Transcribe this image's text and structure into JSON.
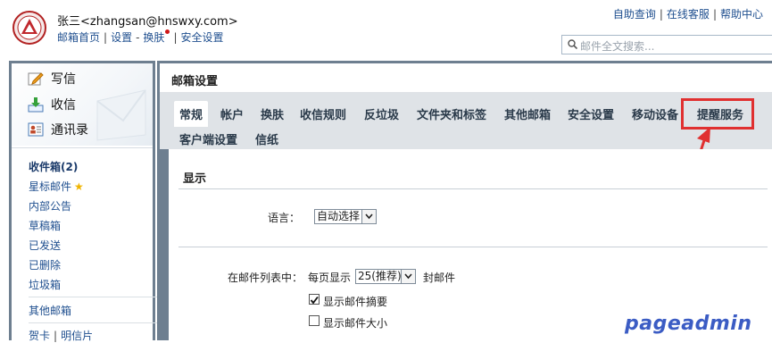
{
  "header": {
    "user": "张三<zhangsan@hnswxy.com>",
    "links": [
      "邮箱首页",
      "设置",
      "换肤",
      "安全设置"
    ],
    "help_links": [
      "自助查询",
      "在线客服",
      "帮助中心"
    ],
    "search_placeholder": "邮件全文搜索..."
  },
  "sidebar": {
    "actions": [
      {
        "label": "写信",
        "icon": "compose-icon"
      },
      {
        "label": "收信",
        "icon": "inbox-download-icon"
      },
      {
        "label": "通讯录",
        "icon": "contacts-icon"
      }
    ],
    "folders": [
      "收件箱(2)",
      "星标邮件",
      "内部公告",
      "草稿箱",
      "已发送",
      "已删除",
      "垃圾箱"
    ],
    "other": "其他邮箱",
    "bottom": [
      "贺卡",
      "明信片"
    ]
  },
  "main": {
    "title": "邮箱设置",
    "tabs": [
      "常规",
      "帐户",
      "换肤",
      "收信规则",
      "反垃圾",
      "文件夹和标签",
      "其他邮箱",
      "安全设置",
      "移动设备",
      "提醒服务",
      "客户端设置",
      "信纸"
    ],
    "active_tab": "常规",
    "highlighted_tab": "提醒服务",
    "section_title": "显示",
    "language_label": "语言：",
    "language_value": "自动选择",
    "list_label": "在邮件列表中：",
    "per_page_label": "每页显示",
    "per_page_value": "25(推荐)",
    "per_page_unit": "封邮件",
    "show_summary": {
      "label": "显示邮件摘要",
      "checked": true
    },
    "show_size": {
      "label": "显示邮件大小",
      "checked": false
    }
  },
  "watermark": "pageadmin",
  "colors": {
    "accent_red": "#e03030",
    "link_blue": "#1f4f8f",
    "watermark_blue": "#3b5cc4"
  }
}
